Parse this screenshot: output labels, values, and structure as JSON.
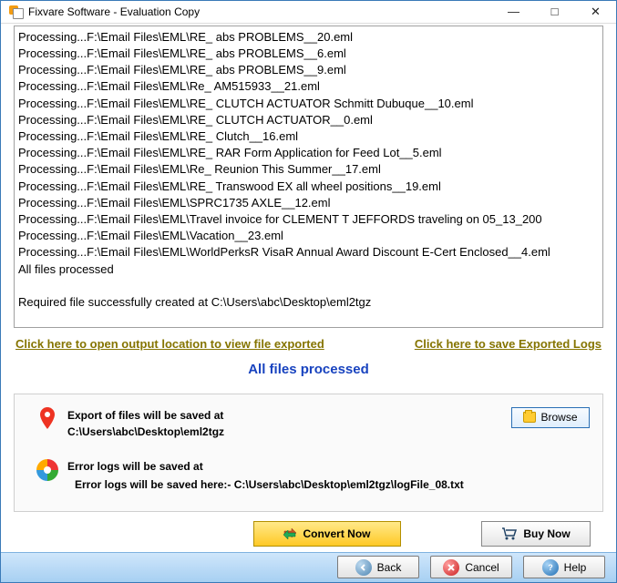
{
  "window": {
    "title": "Fixvare Software - Evaluation Copy"
  },
  "log_lines": [
    "Processing...F:\\Email Files\\EML\\RE_ abs PROBLEMS__20.eml",
    "Processing...F:\\Email Files\\EML\\RE_ abs PROBLEMS__6.eml",
    "Processing...F:\\Email Files\\EML\\RE_ abs PROBLEMS__9.eml",
    "Processing...F:\\Email Files\\EML\\Re_ AM515933__21.eml",
    "Processing...F:\\Email Files\\EML\\RE_ CLUTCH ACTUATOR Schmitt Dubuque__10.eml",
    "Processing...F:\\Email Files\\EML\\RE_ CLUTCH ACTUATOR__0.eml",
    "Processing...F:\\Email Files\\EML\\RE_ Clutch__16.eml",
    "Processing...F:\\Email Files\\EML\\RE_ RAR Form Application for Feed Lot__5.eml",
    "Processing...F:\\Email Files\\EML\\Re_ Reunion This Summer__17.eml",
    "Processing...F:\\Email Files\\EML\\RE_ Transwood EX all wheel positions__19.eml",
    "Processing...F:\\Email Files\\EML\\SPRC1735 AXLE__12.eml",
    "Processing...F:\\Email Files\\EML\\Travel invoice for CLEMENT T JEFFORDS traveling on 05_13_200",
    "Processing...F:\\Email Files\\EML\\Vacation__23.eml",
    "Processing...F:\\Email Files\\EML\\WorldPerksR VisaR Annual Award Discount E-Cert Enclosed__4.eml",
    "All files processed",
    "",
    "Required file successfully created at C:\\Users\\abc\\Desktop\\eml2tgz"
  ],
  "links": {
    "open_output": "Click here to open output location to view file exported",
    "save_logs": "Click here to save Exported Logs"
  },
  "status_text": "All files processed",
  "export": {
    "label": "Export of files will be saved at",
    "path": "C:\\Users\\abc\\Desktop\\eml2tgz",
    "browse_label": "Browse"
  },
  "error_logs": {
    "label": "Error logs will be saved at",
    "detail": "Error logs will be saved here:- C:\\Users\\abc\\Desktop\\eml2tgz\\logFile_08.txt"
  },
  "buttons": {
    "convert": "Convert Now",
    "buy": "Buy Now",
    "back": "Back",
    "cancel": "Cancel",
    "help": "Help"
  },
  "colors": {
    "accent_blue": "#1843bf",
    "link_olive": "#857400",
    "bottombar": "#a7d0f2"
  }
}
